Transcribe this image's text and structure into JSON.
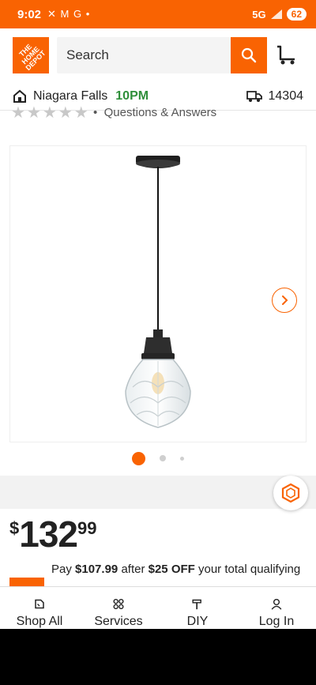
{
  "status": {
    "time": "9:02",
    "icons": "✕ M G •",
    "network": "5G",
    "battery": "62"
  },
  "header": {
    "logo_text": "THE HOME DEPOT",
    "search_placeholder": "Search"
  },
  "store": {
    "name": "Niagara Falls",
    "hours": "10PM",
    "zip": "14304"
  },
  "reviews": {
    "link": "Questions & Answers"
  },
  "price": {
    "symbol": "$",
    "dollars": "132",
    "cents": "99"
  },
  "promo": {
    "prefix": "Pay",
    "discounted": "$107.99",
    "middle": "after",
    "offer": "$25 OFF",
    "suffix": "your total qualifying"
  },
  "nav": [
    {
      "label": "Shop All"
    },
    {
      "label": "Services"
    },
    {
      "label": "DIY"
    },
    {
      "label": "Log In"
    }
  ],
  "colors": {
    "brand": "#f96302",
    "store_hours": "#2f8f3a"
  }
}
